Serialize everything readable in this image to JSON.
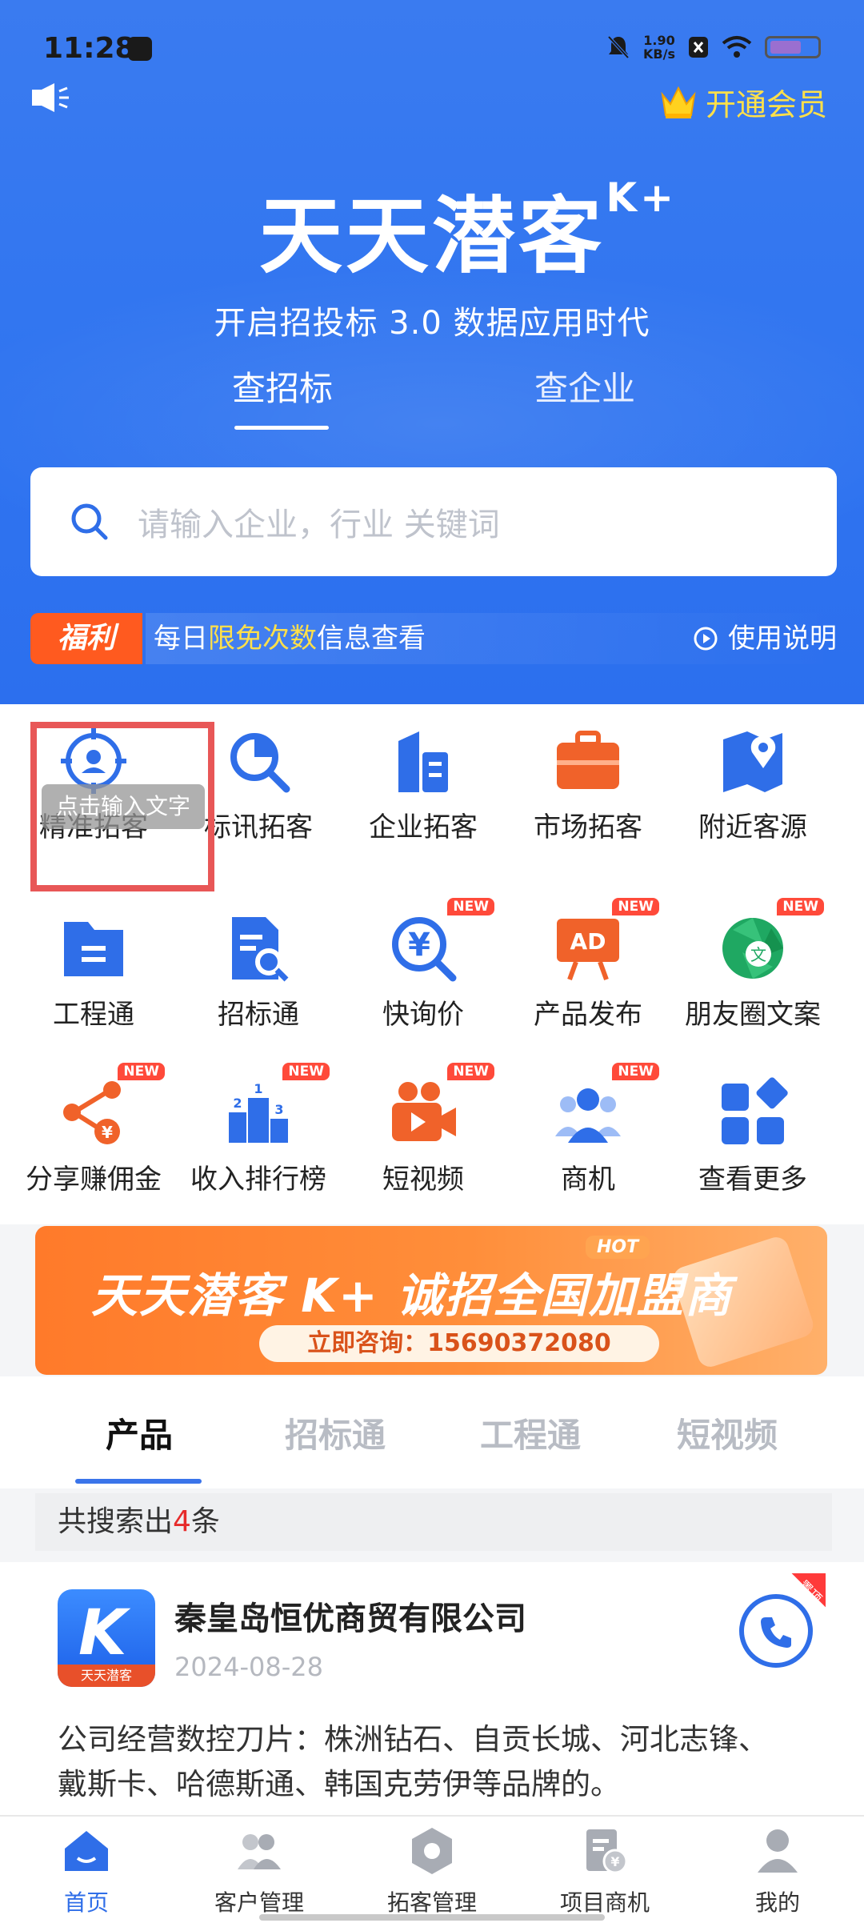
{
  "status_bar": {
    "time": "11:28",
    "speed_value": "1.90",
    "speed_unit": "KB/s"
  },
  "header": {
    "vip_label": "开通会员",
    "brand_title": "天天潜客",
    "brand_sup": "K+",
    "brand_subtitle": "开启招投标 3.0  数据应用时代",
    "tabs": [
      {
        "label": "查招标"
      },
      {
        "label": "查企业"
      }
    ],
    "search_placeholder": "请输入企业，行业 关键词",
    "promo_badge": "福利",
    "promo_text_pre": "每日",
    "promo_text_hl": "限免次数",
    "promo_text_post": "信息查看",
    "help_label": "使用说明"
  },
  "grid": {
    "items": [
      {
        "label": "精准拓客",
        "icon": "target-user-icon"
      },
      {
        "label": "标讯拓客",
        "icon": "search-pie-icon"
      },
      {
        "label": "企业拓客",
        "icon": "building-icon"
      },
      {
        "label": "市场拓客",
        "icon": "briefcase-icon"
      },
      {
        "label": "附近客源",
        "icon": "map-pin-icon"
      },
      {
        "label": "工程通",
        "icon": "folder-icon"
      },
      {
        "label": "招标通",
        "icon": "document-search-icon"
      },
      {
        "label": "快询价",
        "icon": "yuan-search-icon",
        "badge": "NEW"
      },
      {
        "label": "产品发布",
        "icon": "ad-board-icon",
        "badge": "NEW"
      },
      {
        "label": "朋友圈文案",
        "icon": "aperture-icon",
        "badge": "NEW"
      },
      {
        "label": "分享赚佣金",
        "icon": "share-yuan-icon",
        "badge": "NEW"
      },
      {
        "label": "收入排行榜",
        "icon": "podium-icon",
        "badge": "NEW"
      },
      {
        "label": "短视频",
        "icon": "video-camera-icon",
        "badge": "NEW"
      },
      {
        "label": "商机",
        "icon": "people-icon",
        "badge": "NEW"
      },
      {
        "label": "查看更多",
        "icon": "grid-more-icon"
      }
    ],
    "tooltip": "点击输入文字"
  },
  "banner": {
    "title": "天天潜客 K+ 诚招全国加盟商",
    "hot": "HOT",
    "phone": "立即咨询：15690372080"
  },
  "product_tabs": [
    {
      "label": "产品"
    },
    {
      "label": "招标通"
    },
    {
      "label": "工程通"
    },
    {
      "label": "短视频"
    }
  ],
  "results": {
    "count_prefix": "共搜索出",
    "count": "4",
    "count_suffix": "条",
    "card": {
      "company": "秦皇岛恒优商贸有限公司",
      "date": "2024-08-28",
      "corner_tag": "置顶",
      "logo_text": "天天潜客",
      "logo_letter": "K",
      "description": "公司经营数控刀片：株洲钻石、自贡长城、河北志锋、戴斯卡、哈德斯通、韩国克劳伊等品牌的。"
    }
  },
  "bottom_nav": [
    {
      "label": "首页"
    },
    {
      "label": "客户管理"
    },
    {
      "label": "拓客管理"
    },
    {
      "label": "项目商机"
    },
    {
      "label": "我的"
    }
  ],
  "colors": {
    "primary": "#2f74f0",
    "accent_orange": "#ff5a1f",
    "vip_gold": "#ffe04a",
    "new_badge": "#ff4a3a"
  }
}
